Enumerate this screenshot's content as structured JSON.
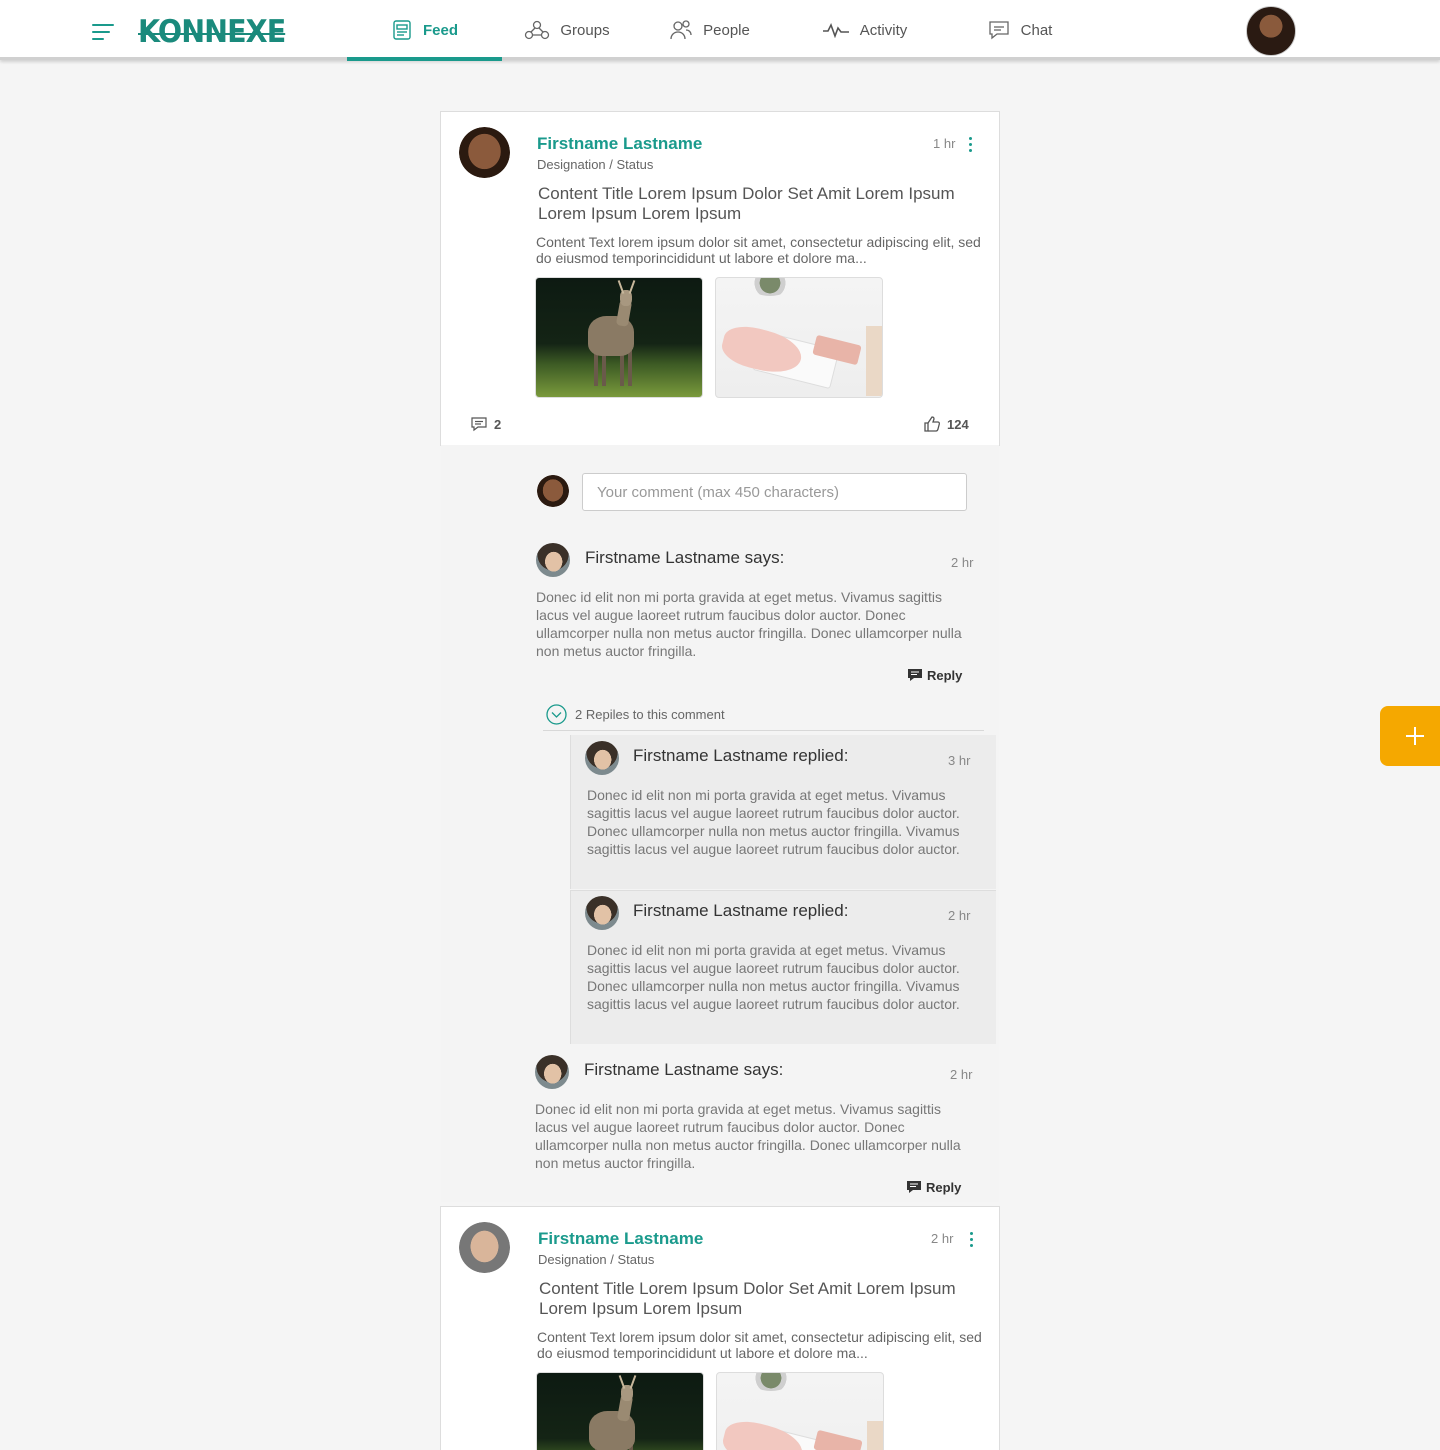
{
  "app": {
    "logo": "KONNEXE"
  },
  "nav": {
    "items": [
      {
        "label": "Feed",
        "icon": "feed-icon",
        "active": true
      },
      {
        "label": "Groups",
        "icon": "groups-icon"
      },
      {
        "label": "People",
        "icon": "people-icon"
      },
      {
        "label": "Activity",
        "icon": "activity-icon"
      },
      {
        "label": "Chat",
        "icon": "chat-icon"
      }
    ]
  },
  "colors": {
    "accent": "#1a9a8c",
    "fab": "#f5a800"
  },
  "posts": [
    {
      "author": "Firstname Lastname",
      "designation": "Designation / Status",
      "time": "1 hr",
      "title": "Content Title Lorem Ipsum Dolor Set Amit Lorem Ipsum Lorem Ipsum Lorem Ipsum",
      "text": "Content Text lorem ipsum dolor sit amet, consectetur adipiscing elit, sed do eiusmod temporincididunt ut labore et dolore ma...",
      "comment_count": "2",
      "like_count": "124"
    },
    {
      "author": "Firstname Lastname",
      "designation": "Designation / Status",
      "time": "2 hr",
      "title": "Content Title Lorem Ipsum Dolor Set Amit Lorem Ipsum Lorem Ipsum Lorem Ipsum",
      "text": "Content Text lorem ipsum dolor sit amet, consectetur adipiscing elit, sed do eiusmod temporincididunt ut labore et dolore ma..."
    }
  ],
  "comment_input": {
    "placeholder": "Your comment (max 450 characters)"
  },
  "comments": [
    {
      "author": "Firstname Lastname says:",
      "time": "2 hr",
      "body": "Donec id elit non mi porta gravida at eget metus. Vivamus sagittis lacus vel augue laoreet rutrum faucibus dolor auctor. Donec ullamcorper nulla non metus auctor fringilla. Donec ullamcorper nulla non metus auctor fringilla.",
      "reply_label": "Reply"
    },
    {
      "author": "Firstname Lastname says:",
      "time": "2 hr",
      "body": "Donec id elit non mi porta gravida at eget metus. Vivamus sagittis lacus vel augue laoreet rutrum faucibus dolor auctor. Donec ullamcorper nulla non metus auctor fringilla. Donec ullamcorper nulla non metus auctor fringilla.",
      "reply_label": "Reply"
    }
  ],
  "replies_toggle": "2 Repiles to this comment",
  "replies": [
    {
      "author": "Firstname Lastname replied:",
      "time": "3 hr",
      "body": "Donec id elit non mi porta gravida at eget metus. Vivamus sagittis lacus vel augue laoreet rutrum faucibus dolor auctor. Donec ullamcorper nulla non metus auctor fringilla.  Vivamus sagittis lacus vel augue laoreet rutrum faucibus dolor auctor."
    },
    {
      "author": "Firstname Lastname replied:",
      "time": "2 hr",
      "body": "Donec id elit non mi porta gravida at eget metus. Vivamus sagittis lacus vel augue laoreet rutrum faucibus dolor auctor. Donec ullamcorper nulla non metus auctor fringilla.  Vivamus sagittis lacus vel augue laoreet rutrum faucibus dolor auctor."
    }
  ],
  "fab": {
    "icon": "plus-icon"
  }
}
